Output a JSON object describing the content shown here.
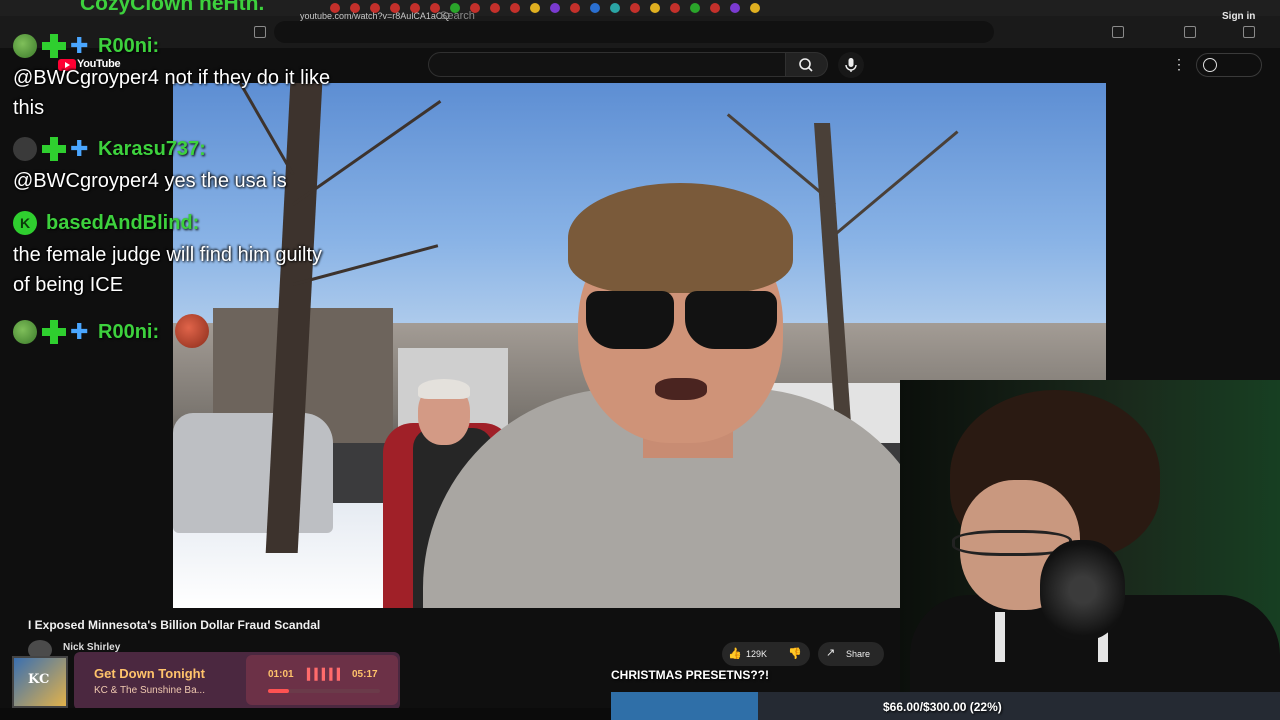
{
  "browser": {
    "url": "youtube.com/watch?v=r8AulCA1aOQ"
  },
  "youtube": {
    "logo_text": "YouTube",
    "search_placeholder": "Search",
    "signin_label": "Sign in"
  },
  "video": {
    "title": "I Exposed Minnesota's Billion Dollar Fraud Scandal",
    "channel": "Nick Shirley",
    "likes": "129K",
    "share_label": "Share"
  },
  "chat": {
    "top_partial": "CozyClown heHth.",
    "messages": [
      {
        "user": "R00ni:",
        "text": "@BWCgroyper4 not if they do it like this"
      },
      {
        "user": "Karasu737:",
        "text": "@BWCgroyper4 yes the usa is"
      },
      {
        "user": "basedAndBlind:",
        "text": "the female judge will find him guilty of being ICE"
      },
      {
        "user": "R00ni:",
        "text": ""
      }
    ]
  },
  "music": {
    "art_text": "KC",
    "title": "Get Down Tonight",
    "artist": "KC & The Sunshine Ba...",
    "elapsed": "01:01",
    "total": "05:17",
    "progress": 0.19
  },
  "goal": {
    "title": "CHRISTMAS PRESETNS??!",
    "label": "$66.00/$300.00 (22%)",
    "progress": 0.22
  },
  "colors": {
    "chat_name": "#3dd13d",
    "goal_fill": "#2f6fa8",
    "music_title": "#ffc36b"
  }
}
